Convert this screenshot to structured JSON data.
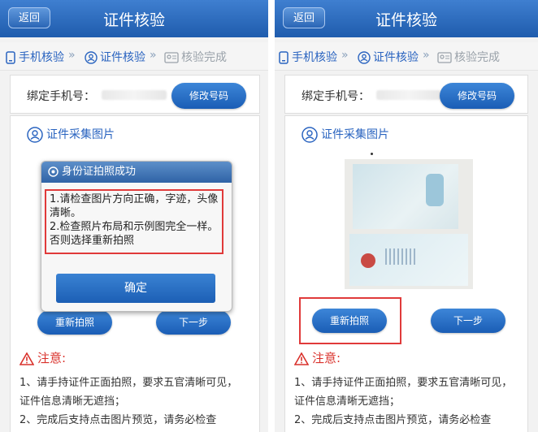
{
  "left": {
    "back_label": "返回",
    "title": "证件核验",
    "steps": [
      "手机核验",
      "证件核验",
      "核验完成"
    ],
    "phone_label": "绑定手机号：",
    "change_label": "修改号码",
    "collect_title": "证件采集图片",
    "dialog": {
      "title": "身份证拍照成功",
      "line1": "1.请检查图片方向正确，字迹，头像清晰。",
      "line2": "2.检查照片布局和示例图完全一样。否则选择重新拍照",
      "ok_label": "确定"
    },
    "retake_label": "重新拍照",
    "next_label": "下一步",
    "notice_title": "注意:",
    "notice_1": "1、请手持证件正面拍照，要求五官清晰可见，证件信息清晰无遮挡；",
    "notice_2": "2、完成后支持点击图片预览，请务必检查"
  },
  "right": {
    "back_label": "返回",
    "title": "证件核验",
    "steps": [
      "手机核验",
      "证件核验",
      "核验完成"
    ],
    "phone_label": "绑定手机号：",
    "change_label": "修改号码",
    "collect_title": "证件采集图片",
    "retake_label": "重新拍照",
    "next_label": "下一步",
    "notice_title": "注意:",
    "notice_1": "1、请手持证件正面拍照，要求五官清晰可见，证件信息清晰无遮挡；",
    "notice_2": "2、完成后支持点击图片预览，请务必检查"
  },
  "colors": {
    "accent": "#1f5cad",
    "warning": "#d9312b",
    "highlight": "#e03a3a"
  }
}
